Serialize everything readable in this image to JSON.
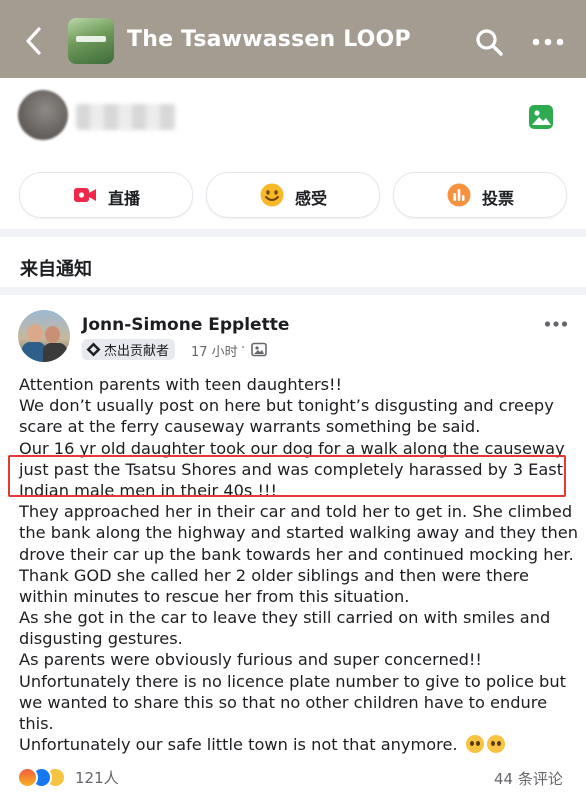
{
  "header": {
    "title": "The Tsawwassen LOOP",
    "bg_color": "#a59c91",
    "back_icon": "chevron-left-icon",
    "search_icon": "search-icon",
    "more_icon": "more-icon"
  },
  "composer": {
    "photo_icon": "photo-icon",
    "photo_color": "#2dab4e"
  },
  "actions": [
    {
      "label": "直播",
      "icon": "live-video-icon",
      "color": "#f02849"
    },
    {
      "label": "感受",
      "icon": "feeling-icon",
      "color": "#f7b928"
    },
    {
      "label": "投票",
      "icon": "poll-icon",
      "color": "#f5923e"
    }
  ],
  "section": {
    "title": "来自通知"
  },
  "post": {
    "author": "Jonn-Simone Epplette",
    "badge": "杰出贡献者",
    "time": "17 小时",
    "dot": "·",
    "lines": [
      "Attention parents with teen daughters!!",
      "We don’t usually post on here but tonight’s disgusting and creepy",
      "scare at the ferry causeway warrants something be said.",
      "Our 16 yr old daughter took our dog for a walk along the causeway",
      "just past the Tsatsu Shores and was completely harassed by 3 East",
      "Indian male men in their 40s !!!",
      "They approached her in their car and told her to get in. She climbed",
      "the bank along the highway and started walking away and they then",
      "drove their car up the bank towards her and continued mocking her.",
      "Thank GOD she called her 2 older siblings and then were there",
      "within minutes to rescue her from this situation.",
      "As she got in the car to leave they still carried on with smiles and",
      "disgusting gestures.",
      "As parents were obviously furious and super concerned!!",
      "Unfortunately there is no licence plate number to give to police but",
      "we wanted to share this so that no other children have to endure",
      "this.",
      "Unfortunately our safe little town is not that anymore."
    ],
    "reactions_count": "121人",
    "comments_count": "44 条评论",
    "highlight_color": "#e53935"
  }
}
